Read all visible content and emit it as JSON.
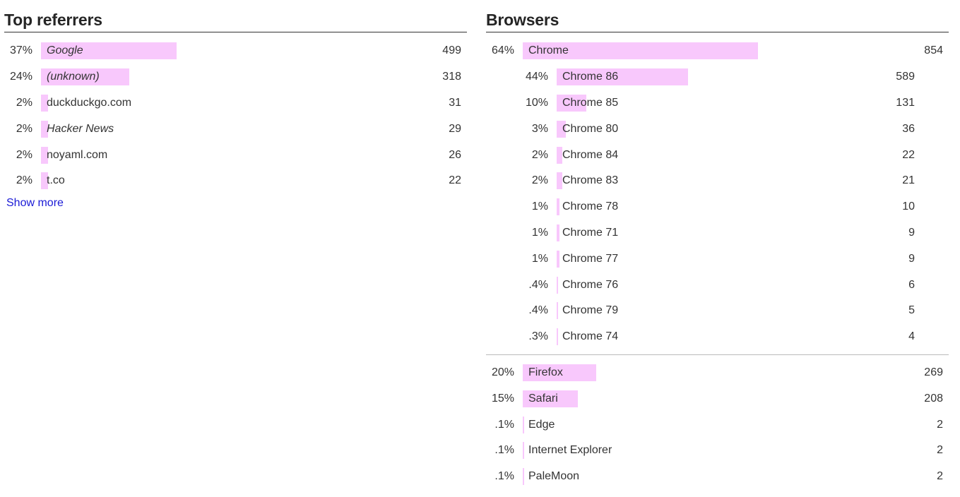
{
  "bar_color": "#f8c8fc",
  "referrers": {
    "title": "Top referrers",
    "show_more_label": "Show more",
    "items": [
      {
        "pct": "37%",
        "share": 0.37,
        "name": "Google",
        "italic": true,
        "count": "499"
      },
      {
        "pct": "24%",
        "share": 0.24,
        "name": "(unknown)",
        "italic": true,
        "count": "318"
      },
      {
        "pct": "2%",
        "share": 0.02,
        "name": "duckduckgo.com",
        "italic": false,
        "count": "31"
      },
      {
        "pct": "2%",
        "share": 0.02,
        "name": "Hacker News",
        "italic": true,
        "count": "29"
      },
      {
        "pct": "2%",
        "share": 0.02,
        "name": "noyaml.com",
        "italic": false,
        "count": "26"
      },
      {
        "pct": "2%",
        "share": 0.02,
        "name": "t.co",
        "italic": false,
        "count": "22"
      }
    ]
  },
  "browsers": {
    "title": "Browsers",
    "chrome": {
      "pct": "64%",
      "share": 0.64,
      "name": "Chrome",
      "count": "854"
    },
    "chrome_versions": [
      {
        "pct": "44%",
        "share": 0.44,
        "name": "Chrome 86",
        "count": "589"
      },
      {
        "pct": "10%",
        "share": 0.1,
        "name": "Chrome 85",
        "count": "131"
      },
      {
        "pct": "3%",
        "share": 0.03,
        "name": "Chrome 80",
        "count": "36"
      },
      {
        "pct": "2%",
        "share": 0.02,
        "name": "Chrome 84",
        "count": "22"
      },
      {
        "pct": "2%",
        "share": 0.02,
        "name": "Chrome 83",
        "count": "21"
      },
      {
        "pct": "1%",
        "share": 0.01,
        "name": "Chrome 78",
        "count": "10"
      },
      {
        "pct": "1%",
        "share": 0.01,
        "name": "Chrome 71",
        "count": "9"
      },
      {
        "pct": "1%",
        "share": 0.01,
        "name": "Chrome 77",
        "count": "9"
      },
      {
        "pct": ".4%",
        "share": 0.004,
        "name": "Chrome 76",
        "count": "6"
      },
      {
        "pct": ".4%",
        "share": 0.004,
        "name": "Chrome 79",
        "count": "5"
      },
      {
        "pct": ".3%",
        "share": 0.003,
        "name": "Chrome 74",
        "count": "4"
      }
    ],
    "others": [
      {
        "pct": "20%",
        "share": 0.2,
        "name": "Firefox",
        "count": "269"
      },
      {
        "pct": "15%",
        "share": 0.15,
        "name": "Safari",
        "count": "208"
      },
      {
        "pct": ".1%",
        "share": 0.001,
        "name": "Edge",
        "count": "2"
      },
      {
        "pct": ".1%",
        "share": 0.001,
        "name": "Internet Explorer",
        "count": "2"
      },
      {
        "pct": ".1%",
        "share": 0.001,
        "name": "PaleMoon",
        "count": "2"
      }
    ]
  }
}
